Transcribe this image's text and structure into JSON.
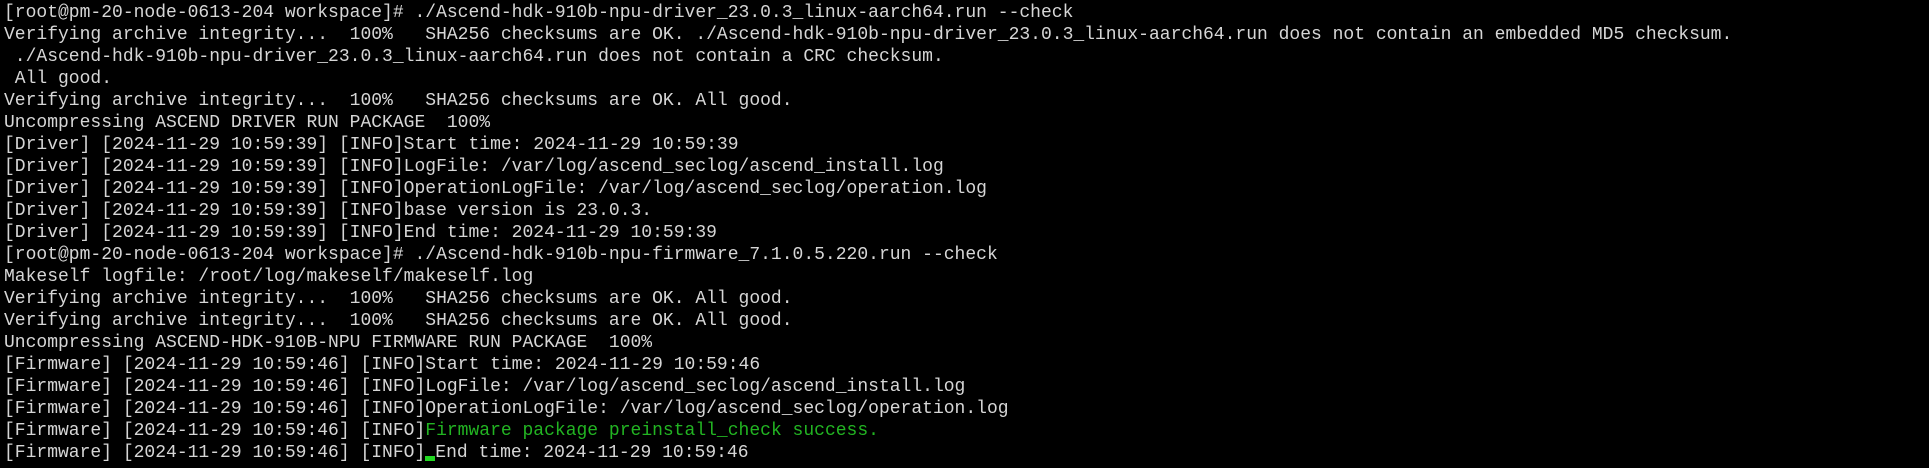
{
  "terminal": {
    "colors": {
      "background": "#000000",
      "foreground": "#d6d6d6",
      "success": "#22b422",
      "cursor": "#22d822"
    },
    "lines": [
      "[root@pm-20-node-0613-204 workspace]# ./Ascend-hdk-910b-npu-driver_23.0.3_linux-aarch64.run --check",
      "Verifying archive integrity...  100%   SHA256 checksums are OK. ./Ascend-hdk-910b-npu-driver_23.0.3_linux-aarch64.run does not contain an embedded MD5 checksum.",
      " ./Ascend-hdk-910b-npu-driver_23.0.3_linux-aarch64.run does not contain a CRC checksum.",
      " All good.",
      "Verifying archive integrity...  100%   SHA256 checksums are OK. All good.",
      "Uncompressing ASCEND DRIVER RUN PACKAGE  100%",
      "[Driver] [2024-11-29 10:59:39] [INFO]Start time: 2024-11-29 10:59:39",
      "[Driver] [2024-11-29 10:59:39] [INFO]LogFile: /var/log/ascend_seclog/ascend_install.log",
      "[Driver] [2024-11-29 10:59:39] [INFO]OperationLogFile: /var/log/ascend_seclog/operation.log",
      "[Driver] [2024-11-29 10:59:39] [INFO]base version is 23.0.3.",
      "[Driver] [2024-11-29 10:59:39] [INFO]End time: 2024-11-29 10:59:39",
      "[root@pm-20-node-0613-204 workspace]# ./Ascend-hdk-910b-npu-firmware_7.1.0.5.220.run --check",
      "Makeself logfile: /root/log/makeself/makeself.log",
      "Verifying archive integrity...  100%   SHA256 checksums are OK. All good.",
      "Verifying archive integrity...  100%   SHA256 checksums are OK. All good.",
      "Uncompressing ASCEND-HDK-910B-NPU FIRMWARE RUN PACKAGE  100%",
      "[Firmware] [2024-11-29 10:59:46] [INFO]Start time: 2024-11-29 10:59:46",
      "[Firmware] [2024-11-29 10:59:46] [INFO]LogFile: /var/log/ascend_seclog/ascend_install.log",
      "[Firmware] [2024-11-29 10:59:46] [INFO]OperationLogFile: /var/log/ascend_seclog/operation.log"
    ],
    "success_line": {
      "prefix": "[Firmware] [2024-11-29 10:59:46] [INFO]",
      "message": "Firmware package preinstall_check success."
    },
    "last_line": {
      "prefix": "[Firmware] [2024-11-29 10:59:46] [INFO]",
      "message": "End time: 2024-11-29 10:59:46"
    }
  }
}
